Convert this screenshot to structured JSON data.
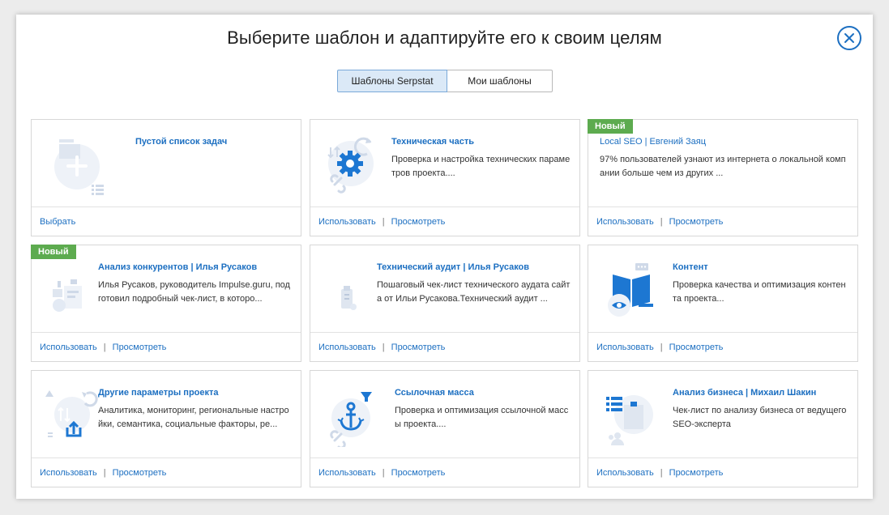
{
  "modal": {
    "title": "Выберите шаблон и адаптируйте его к своим целям",
    "tabs": [
      {
        "label": "Шаблоны Serpstat",
        "active": true
      },
      {
        "label": "Мои шаблоны",
        "active": false
      }
    ]
  },
  "colors": {
    "accent": "#1c6fc1",
    "badge": "#5dab4f",
    "icon_blue": "#1d77d2",
    "icon_bg": "#eef2f8"
  },
  "cards": [
    {
      "title": "Пустой список задач",
      "desc": "",
      "badge": "",
      "icon": "empty-list-icon",
      "actions": [
        "Выбрать"
      ]
    },
    {
      "title": "Техническая часть",
      "desc": "Проверка и настройка технических параметров проекта....",
      "badge": "",
      "icon": "gear-icon",
      "actions": [
        "Использовать",
        "Просмотреть"
      ]
    },
    {
      "title": "Local SEO | Евгений Заяц",
      "desc": "97% пользователей узнают из интернета о локальной компании больше чем из других ...",
      "badge": "Новый",
      "icon": "",
      "actions": [
        "Использовать",
        "Просмотреть"
      ]
    },
    {
      "title": "Анализ конкурентов | Илья Русаков",
      "desc": "Илья Русаков, руководитель Impulse.guru, подготовил подробный чек-лист, в которо...",
      "badge": "Новый",
      "icon": "competitor-analysis-icon",
      "actions": [
        "Использовать",
        "Просмотреть"
      ]
    },
    {
      "title": "Технический аудит | Илья Русаков",
      "desc": "Пошаговый чек-лист технического аудата сайта от Ильи Русакова.Технический аудит ...",
      "badge": "",
      "icon": "tech-audit-icon",
      "actions": [
        "Использовать",
        "Просмотреть"
      ]
    },
    {
      "title": "Контент",
      "desc": "Проверка качества и оптимизация контента проекта...",
      "badge": "",
      "icon": "content-book-icon",
      "actions": [
        "Использовать",
        "Просмотреть"
      ]
    },
    {
      "title": "Другие параметры проекта",
      "desc": "Аналитика, мониторинг, региональные настройки, семантика, социальные факторы, ре...",
      "badge": "",
      "icon": "other-params-icon",
      "actions": [
        "Использовать",
        "Просмотреть"
      ]
    },
    {
      "title": "Ссылочная масса",
      "desc": "Проверка и оптимизация ссылочной массы проекта....",
      "badge": "",
      "icon": "anchor-link-icon",
      "actions": [
        "Использовать",
        "Просмотреть"
      ]
    },
    {
      "title": "Анализ бизнеса | Михаил Шакин",
      "desc": "Чек-лист по анализу бизнеса от ведущего SEO-эксперта",
      "badge": "",
      "icon": "business-analysis-icon",
      "actions": [
        "Использовать",
        "Просмотреть"
      ]
    }
  ]
}
